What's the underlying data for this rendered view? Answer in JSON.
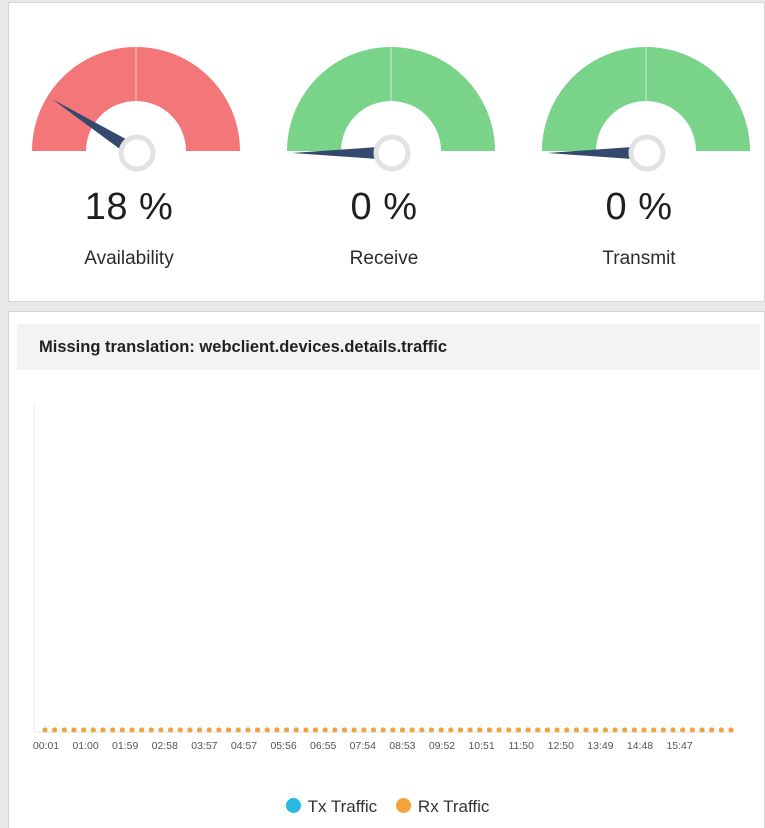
{
  "gauges": [
    {
      "id": "availability",
      "value": 18,
      "unit": "%",
      "display": "18 %",
      "label": "Availability",
      "color": "#f37678"
    },
    {
      "id": "receive",
      "value": 0,
      "unit": "%",
      "display": "0 %",
      "label": "Receive",
      "color": "#79d48a"
    },
    {
      "id": "transmit",
      "value": 0,
      "unit": "%",
      "display": "0 %",
      "label": "Transmit",
      "color": "#79d48a"
    }
  ],
  "gauge_needle_color": "#34496d",
  "traffic": {
    "title": "Missing translation: webclient.devices.details.traffic",
    "legend": [
      {
        "label": "Tx Traffic",
        "color": "#27b9e3"
      },
      {
        "label": "Rx Traffic",
        "color": "#f5a23a"
      }
    ]
  },
  "chart_data": {
    "type": "line",
    "title": "",
    "x_ticks": [
      "00:01",
      "01:00",
      "01:59",
      "02:58",
      "03:57",
      "04:57",
      "05:56",
      "06:55",
      "07:54",
      "08:53",
      "09:52",
      "10:51",
      "11:50",
      "12:50",
      "13:49",
      "14:48",
      "15:47"
    ],
    "point_count": 72,
    "series": [
      {
        "name": "Tx Traffic",
        "value_all_points": 0
      },
      {
        "name": "Rx Traffic",
        "value_all_points": 0
      }
    ],
    "legend_position": "bottom"
  }
}
